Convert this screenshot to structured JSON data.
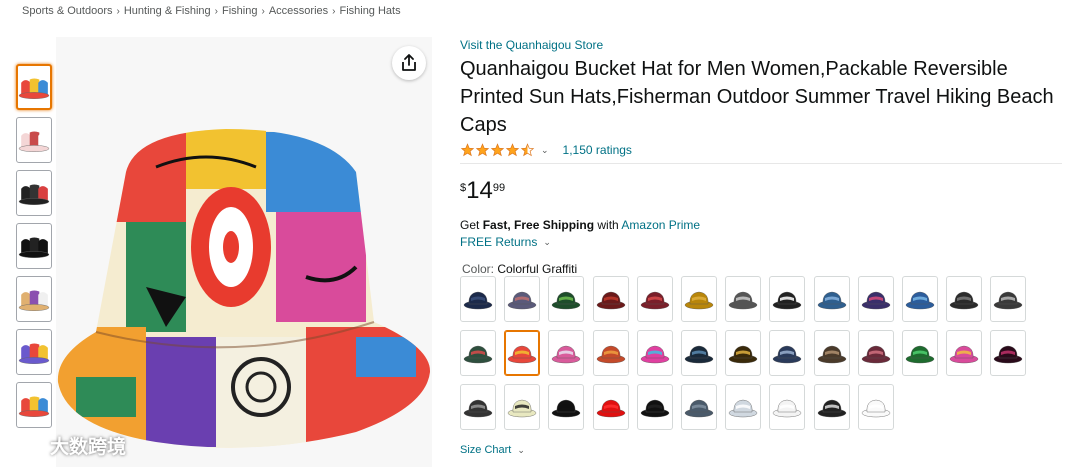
{
  "breadcrumb": [
    "Sports & Outdoors",
    "Hunting & Fishing",
    "Fishing",
    "Accessories",
    "Fishing Hats"
  ],
  "breadcrumb_separator": "›",
  "thumbnails": [
    {
      "name": "thumb-graffiti-hat",
      "colors": [
        "#e8473b",
        "#f2c230",
        "#3b8bd6"
      ]
    },
    {
      "name": "thumb-pattern-hat",
      "colors": [
        "#f4d6d6",
        "#c94a4a",
        "#ffffff"
      ]
    },
    {
      "name": "thumb-black-hat-side",
      "colors": [
        "#222222",
        "#333333",
        "#d94040"
      ]
    },
    {
      "name": "thumb-black-hat",
      "colors": [
        "#111111",
        "#222222",
        "#111111"
      ]
    },
    {
      "name": "thumb-folded-hat",
      "colors": [
        "#e0b070",
        "#8a4fb0",
        "#f0f0f0"
      ]
    },
    {
      "name": "thumb-hat-on-head",
      "colors": [
        "#6a5acd",
        "#e8473b",
        "#f2c230"
      ]
    },
    {
      "name": "thumb-hat-stack",
      "colors": [
        "#e8473b",
        "#f2c230",
        "#3b8bd6"
      ]
    }
  ],
  "share_icon": "share-icon",
  "watermark_text": "大数跨境",
  "store_link": "Visit the Quanhaigou Store",
  "title": "Quanhaigou Bucket Hat for Men Women,Packable Reversible Printed Sun Hats,Fisherman Outdoor Summer Travel Hiking Beach Caps",
  "rating": 4.5,
  "ratings_count": "1,150 ratings",
  "price": {
    "symbol": "$",
    "whole": "14",
    "fraction": "99"
  },
  "shipping": {
    "prefix": "Get ",
    "fast": "Fast, Free Shipping",
    "with": " with ",
    "prime": "Amazon Prime"
  },
  "returns": "FREE Returns",
  "color_label": "Color: ",
  "color_value": "Colorful Graffiti",
  "selected_swatch": 14,
  "swatches": [
    [
      "#1c2a4a",
      "#3a4f7a"
    ],
    [
      "#5a5a7a",
      "#c07070"
    ],
    [
      "#1e4d2b",
      "#6fbf4f"
    ],
    [
      "#6b1a1a",
      "#c0392b"
    ],
    [
      "#7a1f2a",
      "#d94b4b"
    ],
    [
      "#b8860b",
      "#e0b040"
    ],
    [
      "#555555",
      "#cccccc"
    ],
    [
      "#222222",
      "#ffffff"
    ],
    [
      "#2f5f8f",
      "#88b4e0"
    ],
    [
      "#3a2f6a",
      "#d94b7a"
    ],
    [
      "#2c5d9c",
      "#7ab8e8"
    ],
    [
      "#2b2b2b",
      "#7a7a7a"
    ],
    [
      "#3a3a3a",
      "#bbbbbb"
    ],
    [
      "#2e4f3e",
      "#d94b4b"
    ],
    [
      "#e8473b",
      "#f2c230"
    ],
    [
      "#d95b9b",
      "#e8e0f0"
    ],
    [
      "#c44a2a",
      "#f0a040"
    ],
    [
      "#e040a0",
      "#40c0e0"
    ],
    [
      "#1a2a3a",
      "#5a8ab0"
    ],
    [
      "#3a2a0a",
      "#e0b040"
    ],
    [
      "#2a3a5a",
      "#9ab0d0"
    ],
    [
      "#4a3a2a",
      "#b09070"
    ],
    [
      "#6a2a3a",
      "#d07080"
    ],
    [
      "#1e6b2e",
      "#4fcf6f"
    ],
    [
      "#d94b9b",
      "#f0c040"
    ],
    [
      "#2a0a1a",
      "#c0306a"
    ],
    [
      "#333333",
      "#999999"
    ],
    [
      "#e8e8c0",
      "#222222"
    ],
    [
      "#111111",
      "#111111"
    ],
    [
      "#e01010",
      "#ff3030"
    ],
    [
      "#111111",
      "#222222"
    ],
    [
      "#4a5a6a",
      "#8090a0"
    ],
    [
      "#d0d8e0",
      "#ffffff"
    ],
    [
      "#f4f4f4",
      "#ffffff"
    ],
    [
      "#222222",
      "#dddddd"
    ],
    [
      "#fafafa",
      "#ffffff"
    ]
  ],
  "size_chart": "Size Chart",
  "colors": {
    "link": "#007185",
    "selected_border": "#e77600",
    "star": "#ffa41c"
  }
}
